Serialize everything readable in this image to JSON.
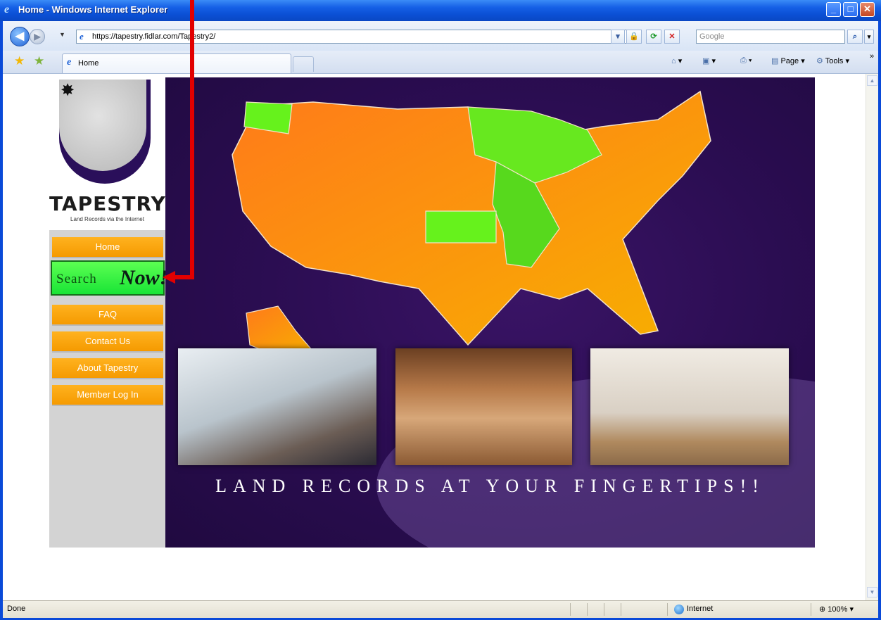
{
  "window": {
    "title": "Home - Windows Internet Explorer",
    "buttons": {
      "minimize": "_",
      "maximize": "□",
      "close": "✕"
    }
  },
  "navbar": {
    "url": "https://tapestry.fidlar.com/Tapestry2/",
    "search_placeholder": "Google"
  },
  "tabs": [
    {
      "label": "Home",
      "active": true
    }
  ],
  "commandbar": {
    "page_label": "Page",
    "tools_label": "Tools"
  },
  "sidebar": {
    "brand": "TAPESTRY",
    "tagline": "Land Records via the Internet",
    "items": [
      {
        "label": "Home"
      },
      {
        "label": "FAQ"
      },
      {
        "label": "Contact Us"
      },
      {
        "label": "About Tapestry"
      },
      {
        "label": "Member Log In"
      }
    ],
    "search_now": {
      "part1": "Search",
      "part2": "Now!"
    }
  },
  "banner": {
    "tagline": "LAND RECORDS AT YOUR FINGERTIPS!!"
  },
  "statusbar": {
    "status": "Done",
    "zone": "Internet",
    "zoom": "100%"
  },
  "colors": {
    "accent_orange": "#f7a000",
    "search_green": "#2ee63b",
    "banner_purple": "#2b0d52",
    "marker_red": "#e20000"
  }
}
